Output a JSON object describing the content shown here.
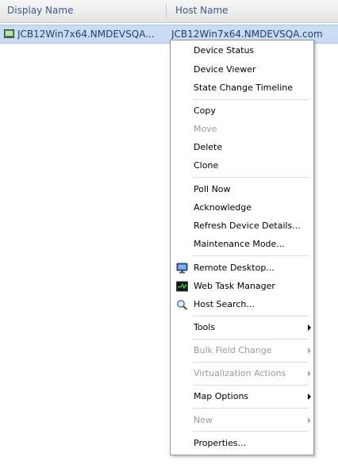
{
  "table": {
    "columns": [
      {
        "label": "Display Name"
      },
      {
        "label": "Host Name"
      }
    ],
    "row": {
      "display_name": "JCB12Win7x64.NMDEVSQA...",
      "host_name": "JCB12Win7x64.NMDEVSQA.com"
    }
  },
  "context_menu": {
    "items": {
      "device_status": "Device Status",
      "device_viewer": "Device Viewer",
      "state_change_timeline": "State Change Timeline",
      "copy": "Copy",
      "move": "Move",
      "delete": "Delete",
      "clone": "Clone",
      "poll_now": "Poll Now",
      "acknowledge": "Acknowledge",
      "refresh_device_details": "Refresh Device Details...",
      "maintenance_mode": "Maintenance Mode...",
      "remote_desktop": "Remote Desktop...",
      "web_task_manager": "Web Task Manager",
      "host_search": "Host Search...",
      "tools": "Tools",
      "bulk_field_change": "Bulk Field Change",
      "virtualization_actions": "Virtualization Actions",
      "map_options": "Map Options",
      "new": "New",
      "properties": "Properties..."
    },
    "disabled": [
      "move",
      "bulk_field_change",
      "virtualization_actions",
      "new"
    ],
    "submenus": [
      "tools",
      "bulk_field_change",
      "virtualization_actions",
      "map_options",
      "new"
    ]
  },
  "icons": {
    "row": "device-icon",
    "remote_desktop": "monitor-icon",
    "web_task_manager": "task-manager-icon",
    "host_search": "magnifier-icon"
  },
  "colors": {
    "header_text": "#3d5a8a",
    "selected_row": "#c9dcf2",
    "row_text": "#1f3f73",
    "disabled_text": "#9a9a9a"
  }
}
